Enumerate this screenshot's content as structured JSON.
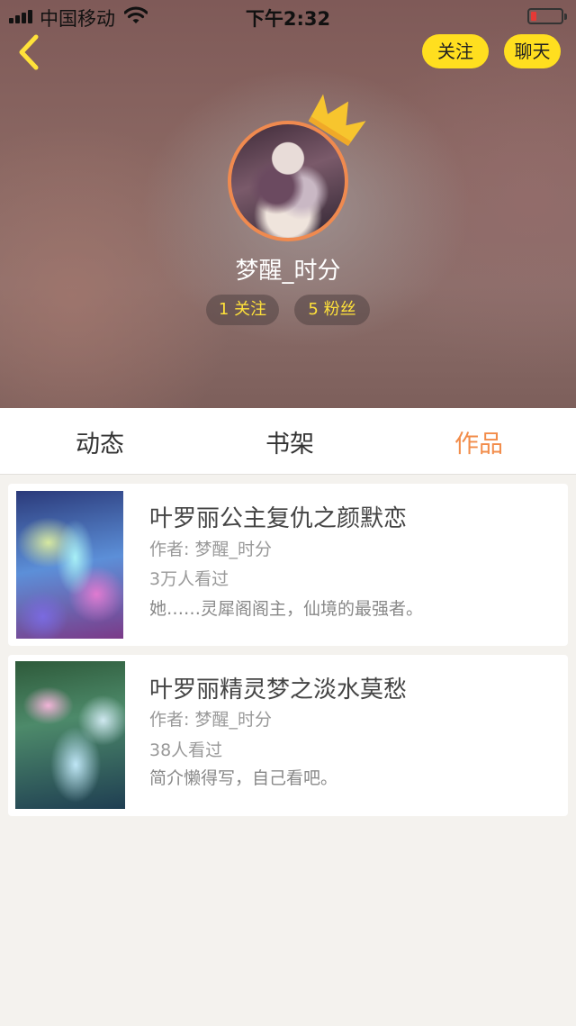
{
  "status_bar": {
    "carrier": "中国移动",
    "time": "下午2:32"
  },
  "header": {
    "back_icon": "chevron-left-icon",
    "follow_label": "关注",
    "chat_label": "聊天",
    "accent_color": "#ffdf1f"
  },
  "profile": {
    "username": "梦醒_时分",
    "following_text": "1 关注",
    "fans_text": "5 粉丝",
    "crown_icon": "crown-icon"
  },
  "tabs": [
    {
      "label": "动态",
      "active": false
    },
    {
      "label": "书架",
      "active": false
    },
    {
      "label": "作品",
      "active": true
    }
  ],
  "active_tab_color": "#f28c4a",
  "works": [
    {
      "title": "叶罗丽公主复仇之颜默恋",
      "author": "作者: 梦醒_时分",
      "views": "3万人看过",
      "description": "她……灵犀阁阁主，仙境的最强者。"
    },
    {
      "title": "叶罗丽精灵梦之淡水莫愁",
      "author": "作者: 梦醒_时分",
      "views": "38人看过",
      "description": "简介懒得写，自己看吧。"
    }
  ]
}
